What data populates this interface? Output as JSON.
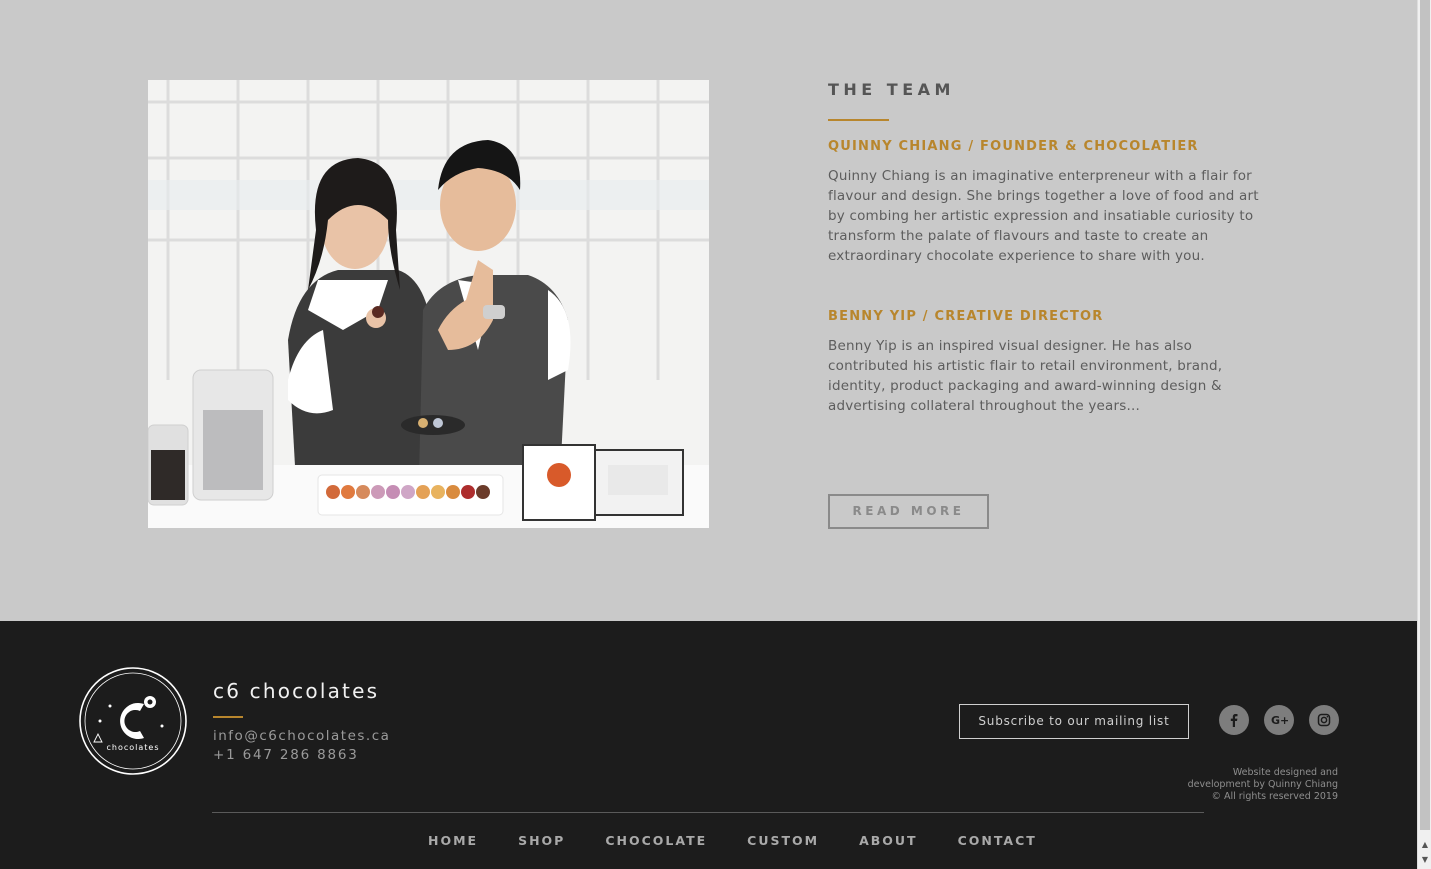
{
  "team": {
    "title": "THE TEAM",
    "members": [
      {
        "name": "QUINNY CHIANG / FOUNDER & CHOCOLATIER",
        "bio": "Quinny Chiang is an imaginative enterpreneur with a flair for flavour and design. She brings together a love of food and art by combing her artistic expression and insatiable curiosity to transform the palate of flavours and taste to create an extraordinary chocolate experience to share with you."
      },
      {
        "name": "BENNY YIP / CREATIVE DIRECTOR",
        "bio": "Benny Yip is an inspired visual designer. He has also contributed his artistic flair to retail environment, brand, identity, product packaging and award-winning design & advertising collateral throughout the years..."
      }
    ],
    "read_more_label": "READ MORE"
  },
  "footer": {
    "brand": "c6 chocolates",
    "logo_text": "chocolates",
    "email": "info@c6chocolates.ca",
    "phone": "+1 647 286 8863",
    "subscribe_label": "Subscribe to our mailing list",
    "social": [
      {
        "icon": "facebook-icon",
        "glyph": "f"
      },
      {
        "icon": "google-plus-icon",
        "glyph": "G+"
      },
      {
        "icon": "instagram-icon",
        "glyph": ""
      }
    ],
    "credits": [
      "Website designed and",
      "development by Quinny Chiang",
      "© All rights reserved 2019"
    ],
    "nav": [
      "HOME",
      "SHOP",
      "CHOCOLATE",
      "CUSTOM",
      "ABOUT",
      "CONTACT"
    ]
  },
  "colors": {
    "accent_gold": "#b8862d",
    "page_bg": "#c9c9c9",
    "footer_bg": "#1c1c1c"
  }
}
